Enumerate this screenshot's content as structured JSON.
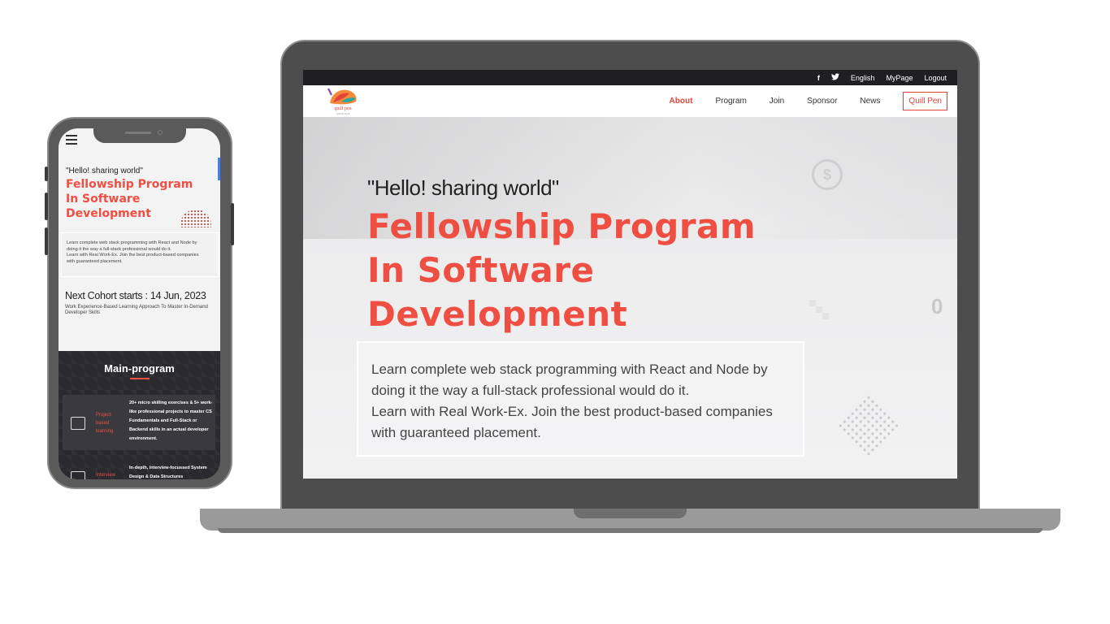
{
  "desktop": {
    "topbar": {
      "facebook": "f",
      "twitter": "🐦",
      "language": "English",
      "mypage": "MyPage",
      "logout": "Logout"
    },
    "logo": {
      "text": "quill pen",
      "sub": "SINCE 2018"
    },
    "nav": {
      "items": [
        {
          "label": "About",
          "active": true
        },
        {
          "label": "Program",
          "active": false
        },
        {
          "label": "Join",
          "active": false
        },
        {
          "label": "Sponsor",
          "active": false
        },
        {
          "label": "News",
          "active": false
        }
      ],
      "cta": "Quill Pen"
    },
    "hero": {
      "quote": "\"Hello! sharing world\"",
      "title_line1": "Fellowship Program",
      "title_line2": "In Software",
      "title_line3": "Development",
      "desc_line1": "Learn complete web stack programming with React and Node by",
      "desc_line2": "doing it the way a full-stack professional would do it.",
      "desc_line3": "Learn with Real Work-Ex. Join the best product-based companies",
      "desc_line4": "with guaranteed placement.",
      "deco_zero": "0",
      "deco_dollar": "$"
    }
  },
  "mobile": {
    "hero": {
      "quote": "\"Hello! sharing world\"",
      "title_line1": "Fellowship Program",
      "title_line2": "In Software",
      "title_line3": "Development",
      "desc_line1": "Learn complete web stack programming with React and Node by",
      "desc_line2": "doing it the way a full-stack professional would do it.",
      "desc_line3": "Learn with Real Work-Ex. Join the best product-based companies",
      "desc_line4": "with guaranteed placement."
    },
    "cohort": {
      "title": "Next Cohort starts : 14 Jun, 2023",
      "subtitle": "Work Experience-Based Learning Approach To Master In-Demand Developer Skills"
    },
    "main_program": {
      "title": "Main-program",
      "cards": [
        {
          "label": "Project based learning",
          "text": "20+ micro skilling exercises & 5+ work-like professional projects to master CS Fundamentals and Full-Stack or Backend skills in an actual developer environment."
        },
        {
          "label": "Interview",
          "text": "In-depth, interview-focussed System Design & Data Structures"
        }
      ]
    }
  },
  "colors": {
    "accent": "#ee4f42",
    "topbar": "#1f1f22",
    "dark_section": "#2a2a2e"
  }
}
